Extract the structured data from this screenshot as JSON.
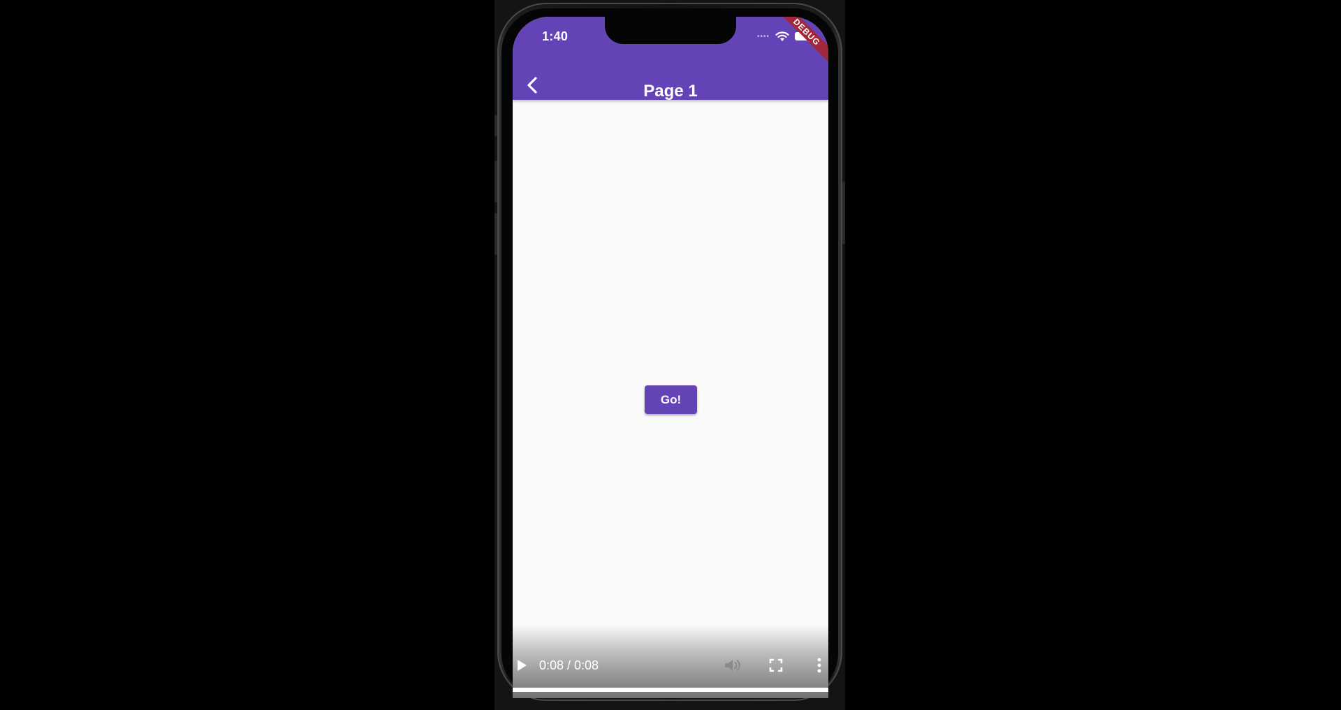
{
  "status_bar": {
    "time": "1:40",
    "signal_icon": "cellular-signal-icon",
    "wifi_icon": "wifi-icon",
    "battery_icon": "battery-icon"
  },
  "debug_banner": {
    "label": "DEBUG",
    "color": "#a0283a"
  },
  "app_bar": {
    "title": "Page 1",
    "back_icon": "chevron-left-icon",
    "color": "#6343b5"
  },
  "body": {
    "button_label": "Go!",
    "background": "#fafafa"
  },
  "video_controls": {
    "time_display": "0:08 / 0:08",
    "progress": 1.0,
    "play_icon": "play-icon",
    "volume_icon": "volume-icon",
    "fullscreen_icon": "fullscreen-icon",
    "more_icon": "more-vertical-icon"
  }
}
